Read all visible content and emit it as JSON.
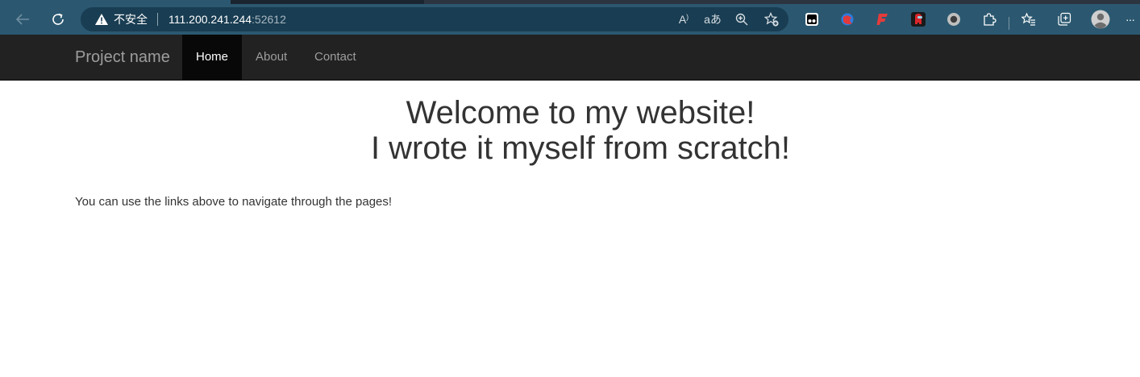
{
  "browser": {
    "security_label": "不安全",
    "url_host": "111.200.241.244",
    "url_port": ":52612",
    "icons": {
      "back": "back-arrow-icon",
      "refresh": "refresh-icon",
      "warning": "warning-triangle-icon",
      "read_aloud": "read-aloud-icon",
      "translate": "translate-icon",
      "zoom": "zoom-icon",
      "add_favorite": "add-favorite-icon",
      "favorites": "favorites-icon",
      "collections": "collections-icon",
      "profile": "profile-avatar-icon",
      "more": "more-icon"
    },
    "read_aloud_glyph": "A",
    "translate_glyph": "aあ",
    "more_glyph": "···",
    "colors": {
      "toolbar": "#2b5870",
      "address_bar": "#193d52"
    }
  },
  "navbar": {
    "brand": "Project name",
    "items": [
      {
        "label": "Home",
        "active": true
      },
      {
        "label": "About",
        "active": false
      },
      {
        "label": "Contact",
        "active": false
      }
    ],
    "colors": {
      "background": "#222222",
      "active_background": "#080808"
    }
  },
  "main": {
    "heading_line1": "Welcome to my website!",
    "heading_line2": "I wrote it myself from scratch!",
    "intro": "You can use the links above to navigate through the pages!"
  }
}
